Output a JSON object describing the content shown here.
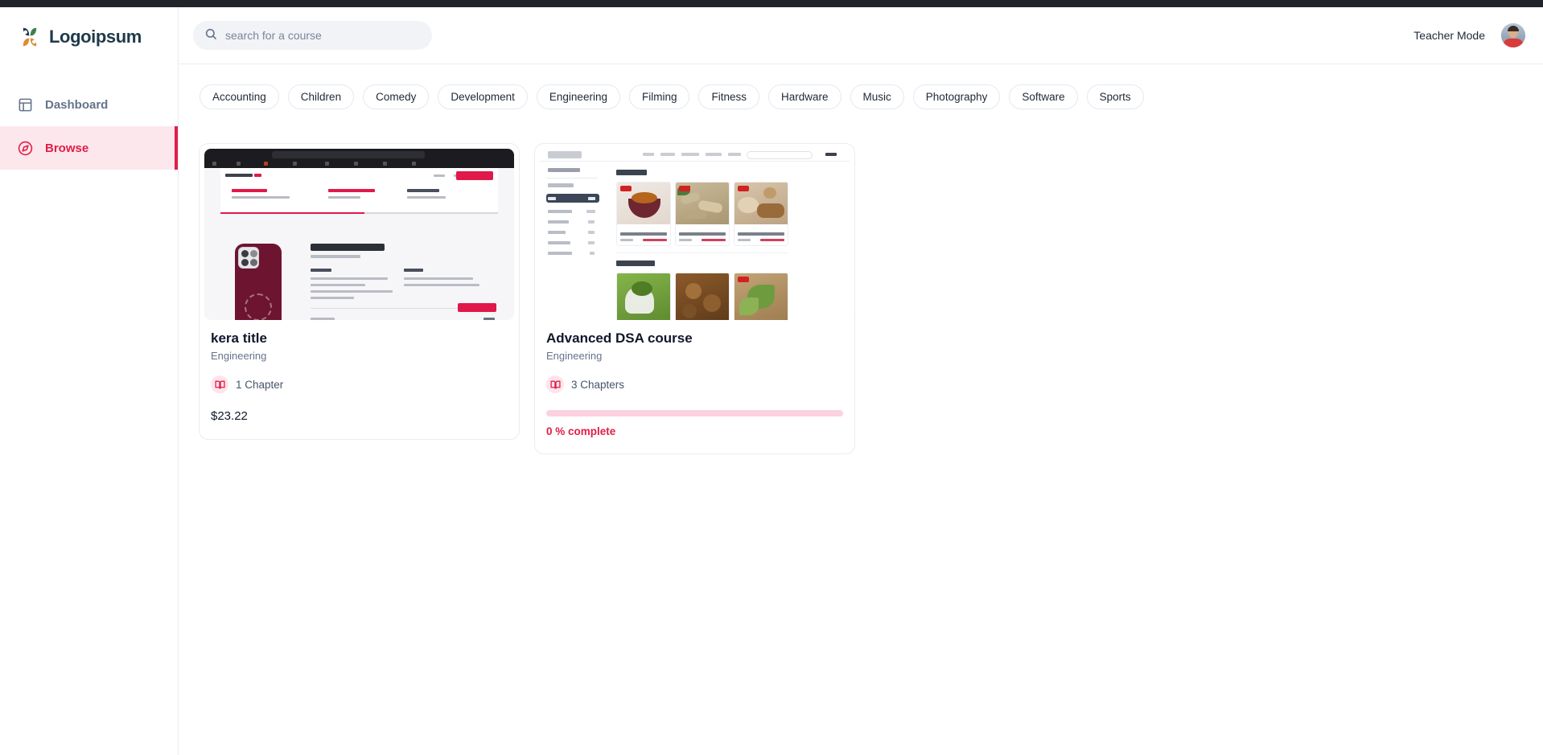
{
  "app": {
    "logo_text": "Logoipsum",
    "topbar_color": "#212529",
    "accent_color": "#e11d48"
  },
  "sidebar": {
    "items": [
      {
        "label": "Dashboard",
        "icon": "layout-dashboard-icon",
        "active": false
      },
      {
        "label": "Browse",
        "icon": "compass-icon",
        "active": true
      }
    ]
  },
  "header": {
    "search": {
      "value": "",
      "placeholder": "search for a course",
      "icon": "search-icon"
    },
    "teacher_mode_label": "Teacher Mode",
    "avatar_name": "user-avatar"
  },
  "categories": [
    {
      "label": "Accounting"
    },
    {
      "label": "Children"
    },
    {
      "label": "Comedy"
    },
    {
      "label": "Development"
    },
    {
      "label": "Engineering"
    },
    {
      "label": "Filming"
    },
    {
      "label": "Fitness"
    },
    {
      "label": "Hardware"
    },
    {
      "label": "Music"
    },
    {
      "label": "Photography"
    },
    {
      "label": "Software"
    },
    {
      "label": "Sports"
    }
  ],
  "courses": [
    {
      "title": "kera title",
      "category": "Engineering",
      "chapters_label": "1 Chapter",
      "chapter_icon": "book-open-icon",
      "price": "$23.22",
      "has_progress": false,
      "thumbnail_alt": "iphone-case-configurator-screenshot"
    },
    {
      "title": "Advanced DSA course",
      "category": "Engineering",
      "chapters_label": "3 Chapters",
      "chapter_icon": "book-open-icon",
      "price": "",
      "has_progress": true,
      "progress_percent": 0,
      "progress_label": "0 % complete",
      "thumbnail_alt": "spice-shop-storefront-screenshot"
    }
  ]
}
